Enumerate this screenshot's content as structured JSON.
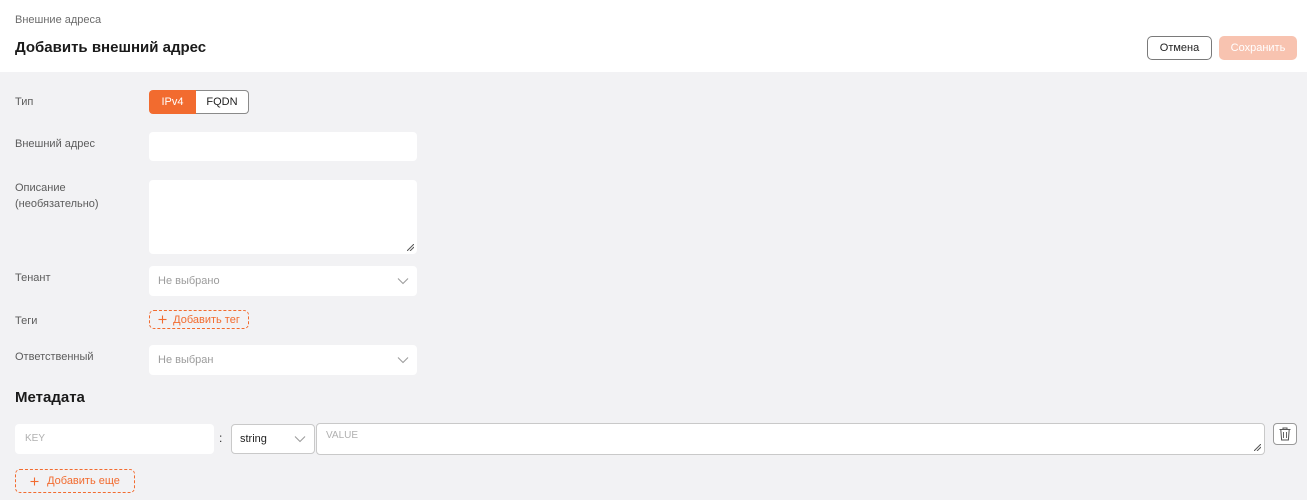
{
  "header": {
    "breadcrumb": "Внешние адреса",
    "title": "Добавить внешний адрес",
    "cancel_label": "Отмена",
    "save_label": "Сохранить"
  },
  "form": {
    "type_label": "Тип",
    "type_options": [
      "IPv4",
      "FQDN"
    ],
    "type_selected": "IPv4",
    "address_label": "Внешний адрес",
    "address_value": "",
    "description_label_line1": "Описание",
    "description_label_line2": "(необязательно)",
    "description_value": "",
    "tenant_label": "Тенант",
    "tenant_value": "Не выбрано",
    "tags_label": "Теги",
    "add_tag_label": "Добавить тег",
    "owner_label": "Ответственный",
    "owner_value": "Не выбран"
  },
  "metadata": {
    "title": "Метадата",
    "key_placeholder": "KEY",
    "separator": ":",
    "type_value": "string",
    "value_placeholder": "VALUE",
    "add_more_label": "Добавить еще"
  },
  "colors": {
    "accent": "#f26b2f",
    "accent_disabled": "#f8c3b0",
    "background": "#f2f2f4"
  },
  "icons": [
    "chevron-down-icon",
    "plus-icon",
    "trash-icon",
    "resize-handle-icon"
  ]
}
